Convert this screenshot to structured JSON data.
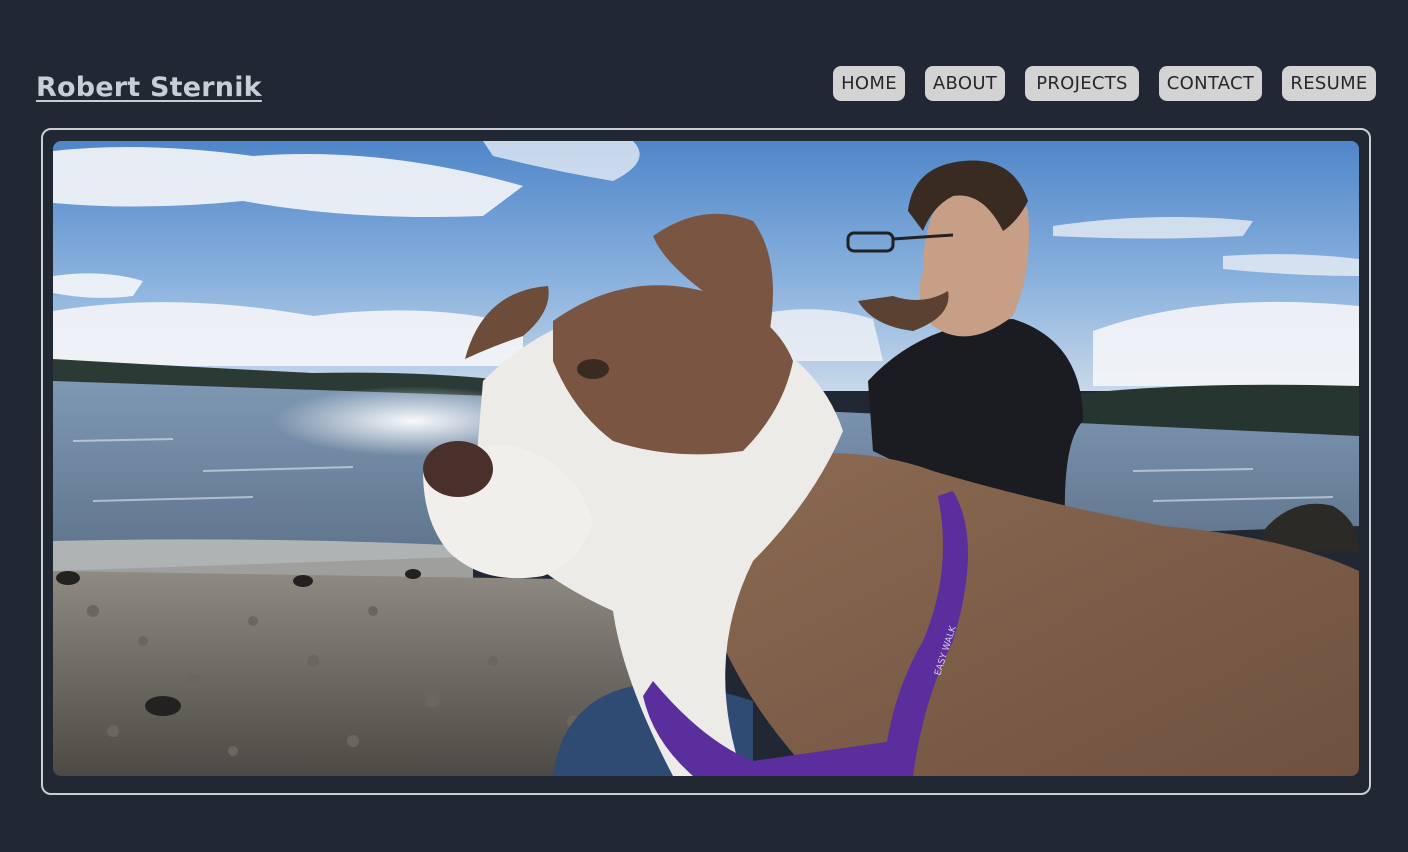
{
  "header": {
    "site_title": "Robert Sternik"
  },
  "nav": {
    "items": [
      {
        "label": "HOME"
      },
      {
        "label": "ABOUT"
      },
      {
        "label": "PROJECTS"
      },
      {
        "label": "CONTACT"
      },
      {
        "label": "RESUME"
      }
    ]
  },
  "hero": {
    "image_alt": "Man with glasses and a brown-and-white dog wearing a purple harness on a pebble beach",
    "harness_text": "EASY WALK"
  },
  "colors": {
    "background": "#212834",
    "title_text": "#c9ced6",
    "nav_button_bg": "#d3d3d3",
    "nav_button_text": "#26282c",
    "frame_border": "#c9ced6"
  }
}
